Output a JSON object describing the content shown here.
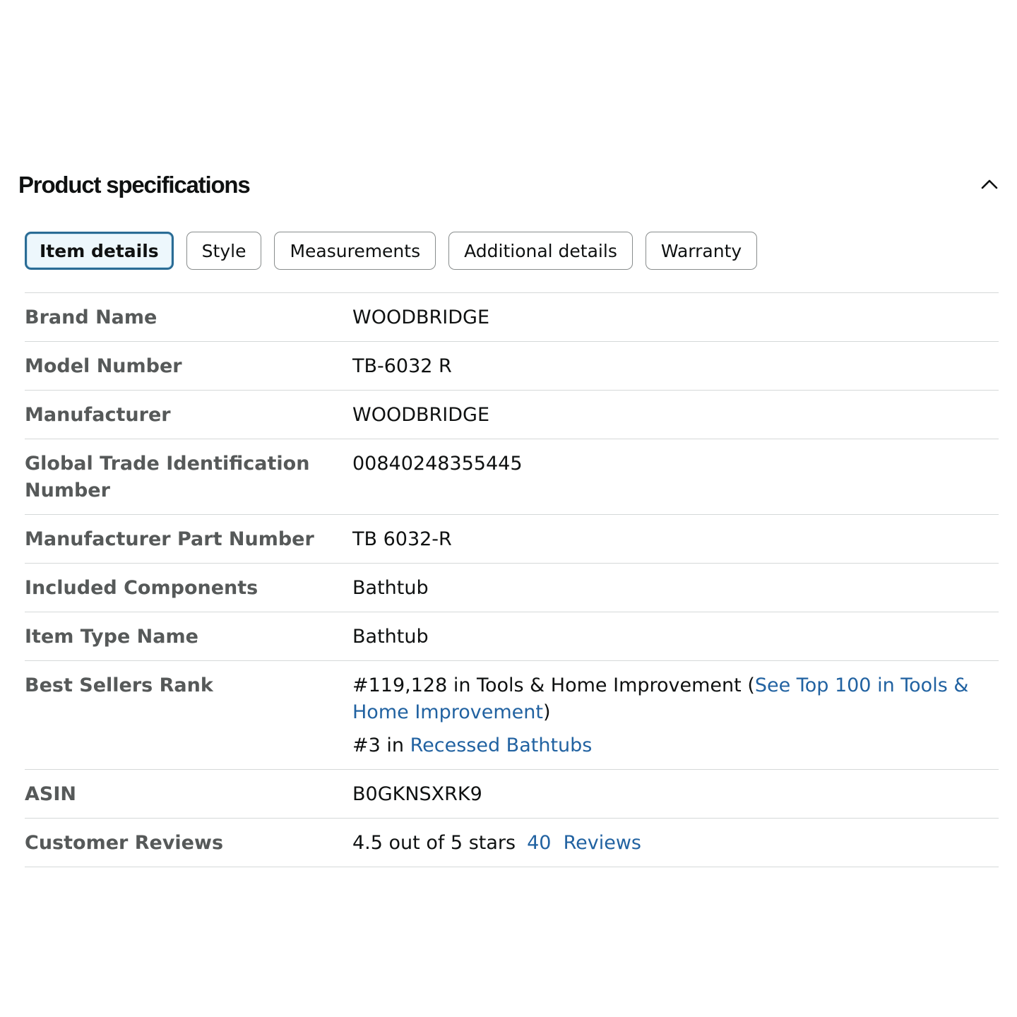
{
  "section": {
    "title": "Product specifications"
  },
  "tabs": [
    {
      "label": "Item details",
      "active": true
    },
    {
      "label": "Style",
      "active": false
    },
    {
      "label": "Measurements",
      "active": false
    },
    {
      "label": "Additional details",
      "active": false
    },
    {
      "label": "Warranty",
      "active": false
    }
  ],
  "specs": {
    "brand_name": {
      "label": "Brand Name",
      "value": "WOODBRIDGE"
    },
    "model_number": {
      "label": "Model Number",
      "value": "TB-6032 R"
    },
    "manufacturer": {
      "label": "Manufacturer",
      "value": "WOODBRIDGE"
    },
    "gtin": {
      "label": "Global Trade Identification Number",
      "value": "00840248355445"
    },
    "part_number": {
      "label": "Manufacturer Part Number",
      "value": "TB 6032-R"
    },
    "included_components": {
      "label": "Included Components",
      "value": "Bathtub"
    },
    "item_type_name": {
      "label": "Item Type Name",
      "value": "Bathtub"
    },
    "best_sellers_rank": {
      "label": "Best Sellers Rank",
      "rank1_prefix": "#119,128 in Tools & Home Improvement (",
      "rank1_link": "See Top 100 in Tools & Home Improvement",
      "rank1_suffix": ")",
      "rank2_prefix": "#3 in ",
      "rank2_link": "Recessed Bathtubs"
    },
    "asin": {
      "label": "ASIN",
      "value": "B0GKNSXRK9"
    },
    "customer_reviews": {
      "label": "Customer Reviews",
      "rating_text": "4.5 out of 5 stars",
      "review_count": "40",
      "reviews_word": "Reviews"
    }
  },
  "icons": {
    "collapse": "chevron-up-icon"
  },
  "colors": {
    "link": "#2162a1",
    "active_tab_border": "#2a6c95",
    "active_tab_bg": "#edf7fc",
    "label_text": "#565959",
    "divider": "#d5d9d9"
  }
}
